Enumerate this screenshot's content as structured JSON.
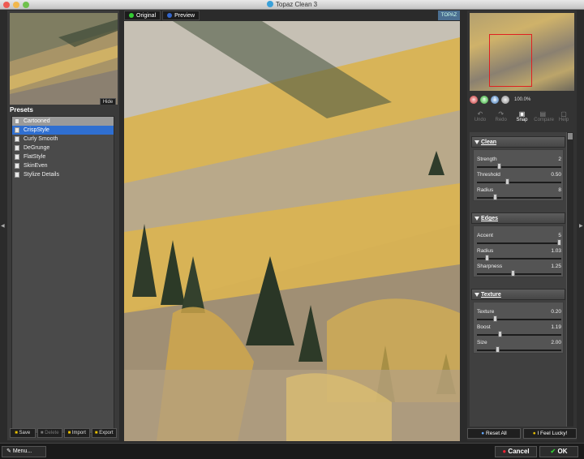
{
  "window": {
    "title": "Topaz Clean 3"
  },
  "left": {
    "hide_label": "Hide",
    "presets_title": "Presets",
    "presets": [
      "Cartooned",
      "CrispStyle",
      "Curly Smooth",
      "DeGrunge",
      "FlatStyle",
      "SkinEven",
      "Stylize Details"
    ],
    "buttons": {
      "save": "Save",
      "delete": "Delete",
      "import": "Import",
      "export": "Export"
    }
  },
  "view_tabs": {
    "original": "Original",
    "preview": "Preview",
    "logo": "TOPAZ"
  },
  "navigator": {
    "zoom": "100.0%"
  },
  "tools": {
    "undo": "Undo",
    "redo": "Redo",
    "snap": "Snap",
    "compare": "Compare",
    "help": "Help"
  },
  "clean": {
    "header": "Clean",
    "params": [
      {
        "label": "Strength",
        "value": "2",
        "level": 0.25
      },
      {
        "label": "Threshold",
        "value": "0.50",
        "level": 0.35
      },
      {
        "label": "Radius",
        "value": "8",
        "level": 0.2
      }
    ]
  },
  "edges": {
    "header": "Edges",
    "params": [
      {
        "label": "Accent",
        "value": "5",
        "level": 1.0
      },
      {
        "label": "Radius",
        "value": "1.03",
        "level": 0.1
      },
      {
        "label": "Sharpness",
        "value": "1.25",
        "level": 0.42
      }
    ]
  },
  "texture": {
    "header": "Texture",
    "params": [
      {
        "label": "Texture",
        "value": "0.20",
        "level": 0.2
      },
      {
        "label": "Boost",
        "value": "1.19",
        "level": 0.26
      },
      {
        "label": "Size",
        "value": "2.00",
        "level": 0.23
      }
    ]
  },
  "right_buttons": {
    "reset": "Reset All",
    "lucky": "I Feel Lucky!"
  },
  "bottom": {
    "menu": "Menu...",
    "cancel": "Cancel",
    "ok": "OK"
  },
  "colors": {
    "selection": "#2f6fd1",
    "accent_red": "#e02020"
  }
}
